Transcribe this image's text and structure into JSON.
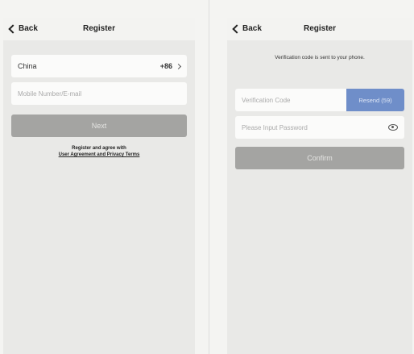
{
  "left": {
    "back_label": "Back",
    "title": "Register",
    "country_label": "China",
    "country_code": "+86",
    "phone_placeholder": "Mobile Number/E-mail",
    "next_label": "Next",
    "agree_line1": "Register and agree with",
    "agree_line2": "User Agreement and Privacy Terms"
  },
  "right": {
    "back_label": "Back",
    "title": "Register",
    "info_text": "Verification code is sent to your phone.",
    "code_placeholder": "Verification Code",
    "resend_label": "Resend (59)",
    "password_placeholder": "Please Input Password",
    "confirm_label": "Confirm"
  },
  "icons": {
    "back": "chevron-left-icon",
    "country_chevron": "chevron-right-icon",
    "password_toggle": "eye-icon"
  },
  "colors": {
    "accent": "#6f8ec9",
    "button_disabled": "#a4a4a2",
    "background": "#e9e9e7"
  }
}
